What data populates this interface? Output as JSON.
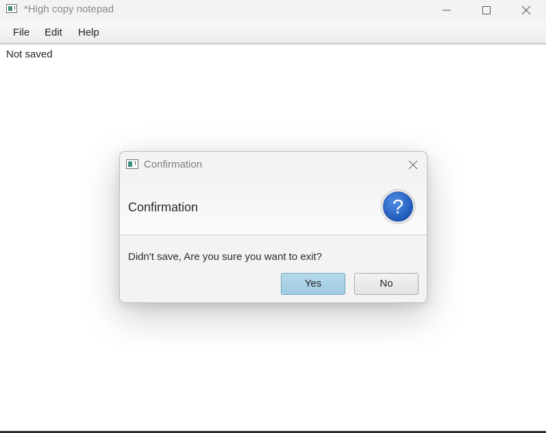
{
  "window": {
    "title": "*High copy notepad",
    "icon": "app-window-icon",
    "controls": [
      "minimize-icon",
      "maximize-icon",
      "close-icon"
    ]
  },
  "menubar": {
    "items": [
      {
        "label": "File"
      },
      {
        "label": "Edit"
      },
      {
        "label": "Help"
      }
    ]
  },
  "main": {
    "status_text": "Not saved"
  },
  "dialog": {
    "title": "Confirmation",
    "header_text": "Confirmation",
    "header_icon": "question-icon",
    "content_text": "Didn't save, Are you sure you want to exit?",
    "buttons": {
      "yes_label": "Yes",
      "no_label": "No"
    },
    "colors": {
      "default_button": "#a9d2e6",
      "question_icon": "#2a63c7"
    }
  }
}
